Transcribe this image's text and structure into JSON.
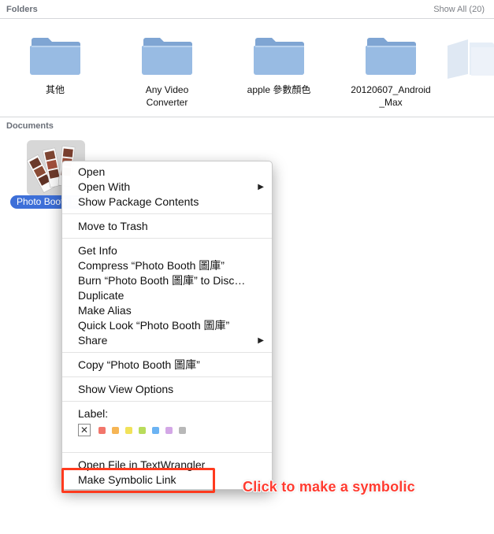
{
  "folders_section": {
    "title": "Folders",
    "show_all": "Show All (20)",
    "items": [
      {
        "label": "其他"
      },
      {
        "label": "Any Video\nConverter"
      },
      {
        "label": "apple 參數顏色"
      },
      {
        "label": "20120607_Android\n_Max"
      }
    ]
  },
  "documents_section": {
    "title": "Documents",
    "item_label": "Photo Booth 圖庫"
  },
  "context_menu": {
    "open": "Open",
    "open_with": "Open With",
    "show_package_contents": "Show Package Contents",
    "move_to_trash": "Move to Trash",
    "get_info": "Get Info",
    "compress": "Compress “Photo Booth 圖庫”",
    "burn": "Burn “Photo Booth 圖庫” to Disc…",
    "duplicate": "Duplicate",
    "make_alias": "Make Alias",
    "quick_look": "Quick Look “Photo Booth 圖庫”",
    "share": "Share",
    "copy": "Copy “Photo Booth 圖庫”",
    "show_view_options": "Show View Options",
    "label_title": "Label:",
    "label_colors": [
      "#f2766b",
      "#f6b555",
      "#f1e25a",
      "#b9dc5b",
      "#6bb3f3",
      "#d3a7e6",
      "#b8b8b8"
    ],
    "open_in_textwrangler": "Open File in TextWrangler",
    "make_symbolic_link": "Make Symbolic Link"
  },
  "annotation": {
    "text": "Click to make a symbolic",
    "color": "#ff3b30"
  },
  "colors": {
    "folder_blue": "#8fb3dc",
    "selection_blue": "#3d6fd8"
  }
}
